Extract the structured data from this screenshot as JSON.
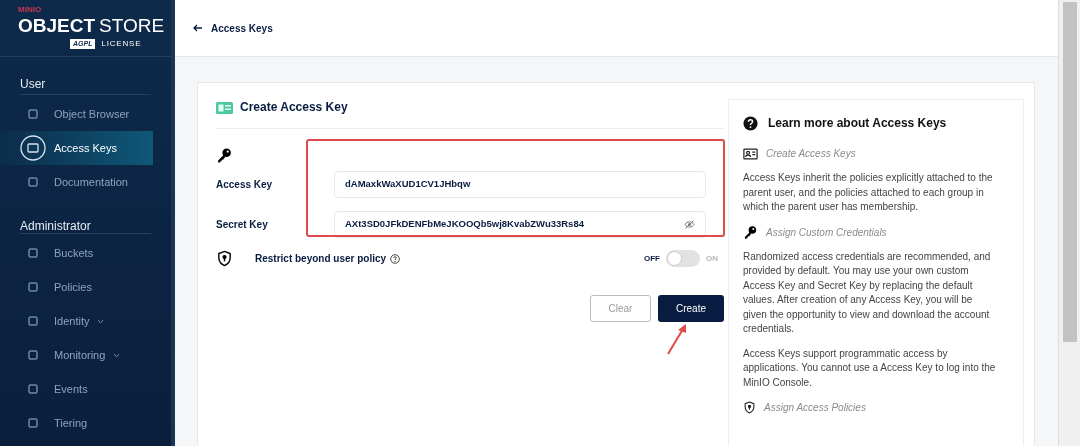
{
  "logo": {
    "brand": "MINIO",
    "product_bold": "OBJECT",
    "product_light": "STORE",
    "badge": "AGPL",
    "license": "LICENSE"
  },
  "sidebar": {
    "sections": [
      {
        "title": "User",
        "items": [
          {
            "label": "Object Browser",
            "selected": false,
            "submenu": false
          },
          {
            "label": "Access Keys",
            "selected": true,
            "submenu": false
          },
          {
            "label": "Documentation",
            "selected": false,
            "submenu": false
          }
        ]
      },
      {
        "title": "Administrator",
        "items": [
          {
            "label": "Buckets",
            "selected": false,
            "submenu": false
          },
          {
            "label": "Policies",
            "selected": false,
            "submenu": false
          },
          {
            "label": "Identity",
            "selected": false,
            "submenu": true
          },
          {
            "label": "Monitoring",
            "selected": false,
            "submenu": true
          },
          {
            "label": "Events",
            "selected": false,
            "submenu": false
          },
          {
            "label": "Tiering",
            "selected": false,
            "submenu": false
          }
        ]
      }
    ]
  },
  "header": {
    "back_label": "Access Keys"
  },
  "form": {
    "title": "Create Access Key",
    "fields": [
      {
        "label": "Access Key",
        "value": "dAMaxkWaXUD1CV1JHbqw",
        "password_toggle": false
      },
      {
        "label": "Secret Key",
        "value": "AXt3SD0JFkDENFbMeJKOOQb5wj8KvabZWu33Rs84",
        "password_toggle": true
      }
    ],
    "restrict": {
      "label": "Restrict beyond user policy",
      "off_label": "OFF",
      "on_label": "ON",
      "on": false
    },
    "buttons": [
      {
        "label": "Clear",
        "kind": "secondary"
      },
      {
        "label": "Create",
        "kind": "primary"
      }
    ]
  },
  "help": {
    "title": "Learn more about Access Keys",
    "blocks": [
      {
        "kind": "heading",
        "text": "Create Access Keys"
      },
      {
        "kind": "paragraph",
        "text": "Access Keys inherit the policies explicitly attached to the parent user, and the policies attached to each group in which the parent user has membership."
      },
      {
        "kind": "heading",
        "text": "Assign Custom Credentials"
      },
      {
        "kind": "paragraph",
        "text": "Randomized access credentials are recommended, and provided by default. You may use your own custom Access Key and Secret Key by replacing the default values. After creation of any Access Key, you will be given the opportunity to view and download the account credentials."
      },
      {
        "kind": "paragraph",
        "text": "Access Keys support programmatic access by applications. You cannot use a Access Key to log into the MinIO Console."
      },
      {
        "kind": "heading",
        "text": "Assign Access Policies"
      }
    ]
  }
}
